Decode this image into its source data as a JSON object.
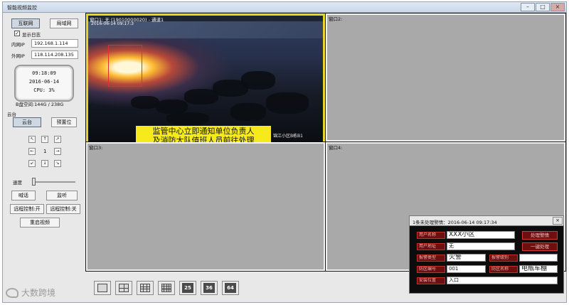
{
  "window": {
    "title": "智能视频监控"
  },
  "left": {
    "internet_button": "互联网",
    "lan_button": "局域网",
    "show_log_label": "显示日志",
    "show_log_checked": true,
    "intranet_label": "内网IP",
    "intranet_ip": "192.168.1.114",
    "extranet_label": "外网IP",
    "extranet_ip": "118.114.208.135",
    "clock": {
      "time": "09:18:09",
      "date": "2016-06-14",
      "cpu": "CPU: 3%"
    },
    "disk": "B盘空间:144G / 238G",
    "ptz_section": "云台",
    "ptz_tab": "云台",
    "preset_tab": "预置位",
    "ptz_center": "1",
    "speed_label": "速度",
    "speed_level": 0.05,
    "talk_button": "喊话",
    "listen_button": "监听",
    "remote_on_button": "远程控制:开",
    "remote_off_button": "远程控制:关",
    "restart_button": "重启视频"
  },
  "panes": [
    {
      "label": "窗口1: 无 (19010000020) - 通道1",
      "active": true
    },
    {
      "label": "窗口2:"
    },
    {
      "label": "窗口3:"
    },
    {
      "label": "窗口4:"
    }
  ],
  "camera": {
    "timestamp": "2016-06-14 09:17:3",
    "caption_line1": "监管中心立即通知单位负责人",
    "caption_line2": "及消防大队值班人员前往处理",
    "location": "锦江小区B栋B1"
  },
  "layouts": [
    {
      "kind": "grid",
      "n": 1,
      "icon": "single-view-icon"
    },
    {
      "kind": "grid",
      "n": 2,
      "icon": "quad-view-icon"
    },
    {
      "kind": "grid",
      "n": 3,
      "icon": "nine-view-icon"
    },
    {
      "kind": "grid",
      "n": 4,
      "icon": "sixteen-view-icon"
    },
    {
      "kind": "num",
      "text": "25"
    },
    {
      "kind": "num",
      "text": "36"
    },
    {
      "kind": "num",
      "text": "64"
    }
  ],
  "alarm": {
    "title": "1条未处理警情：2016-06-14 09:17:34",
    "close": "×",
    "user_name_label": "用户名称",
    "user_name": "XXX小区",
    "user_address_label": "用户地址",
    "user_address": "无",
    "alarm_type_label": "报警类型",
    "alarm_type": "火警",
    "extra_label": "报警级别",
    "extra_value": "",
    "zone_label": "防区编号",
    "zone_value": "001",
    "zone_name_label": "防区名称",
    "zone_name": "电瓶车棚",
    "install_label": "安装位置",
    "install_value": "入口",
    "handle_button": "处理警情",
    "quick_button": "一键处理"
  },
  "watermark": "大数跨境"
}
